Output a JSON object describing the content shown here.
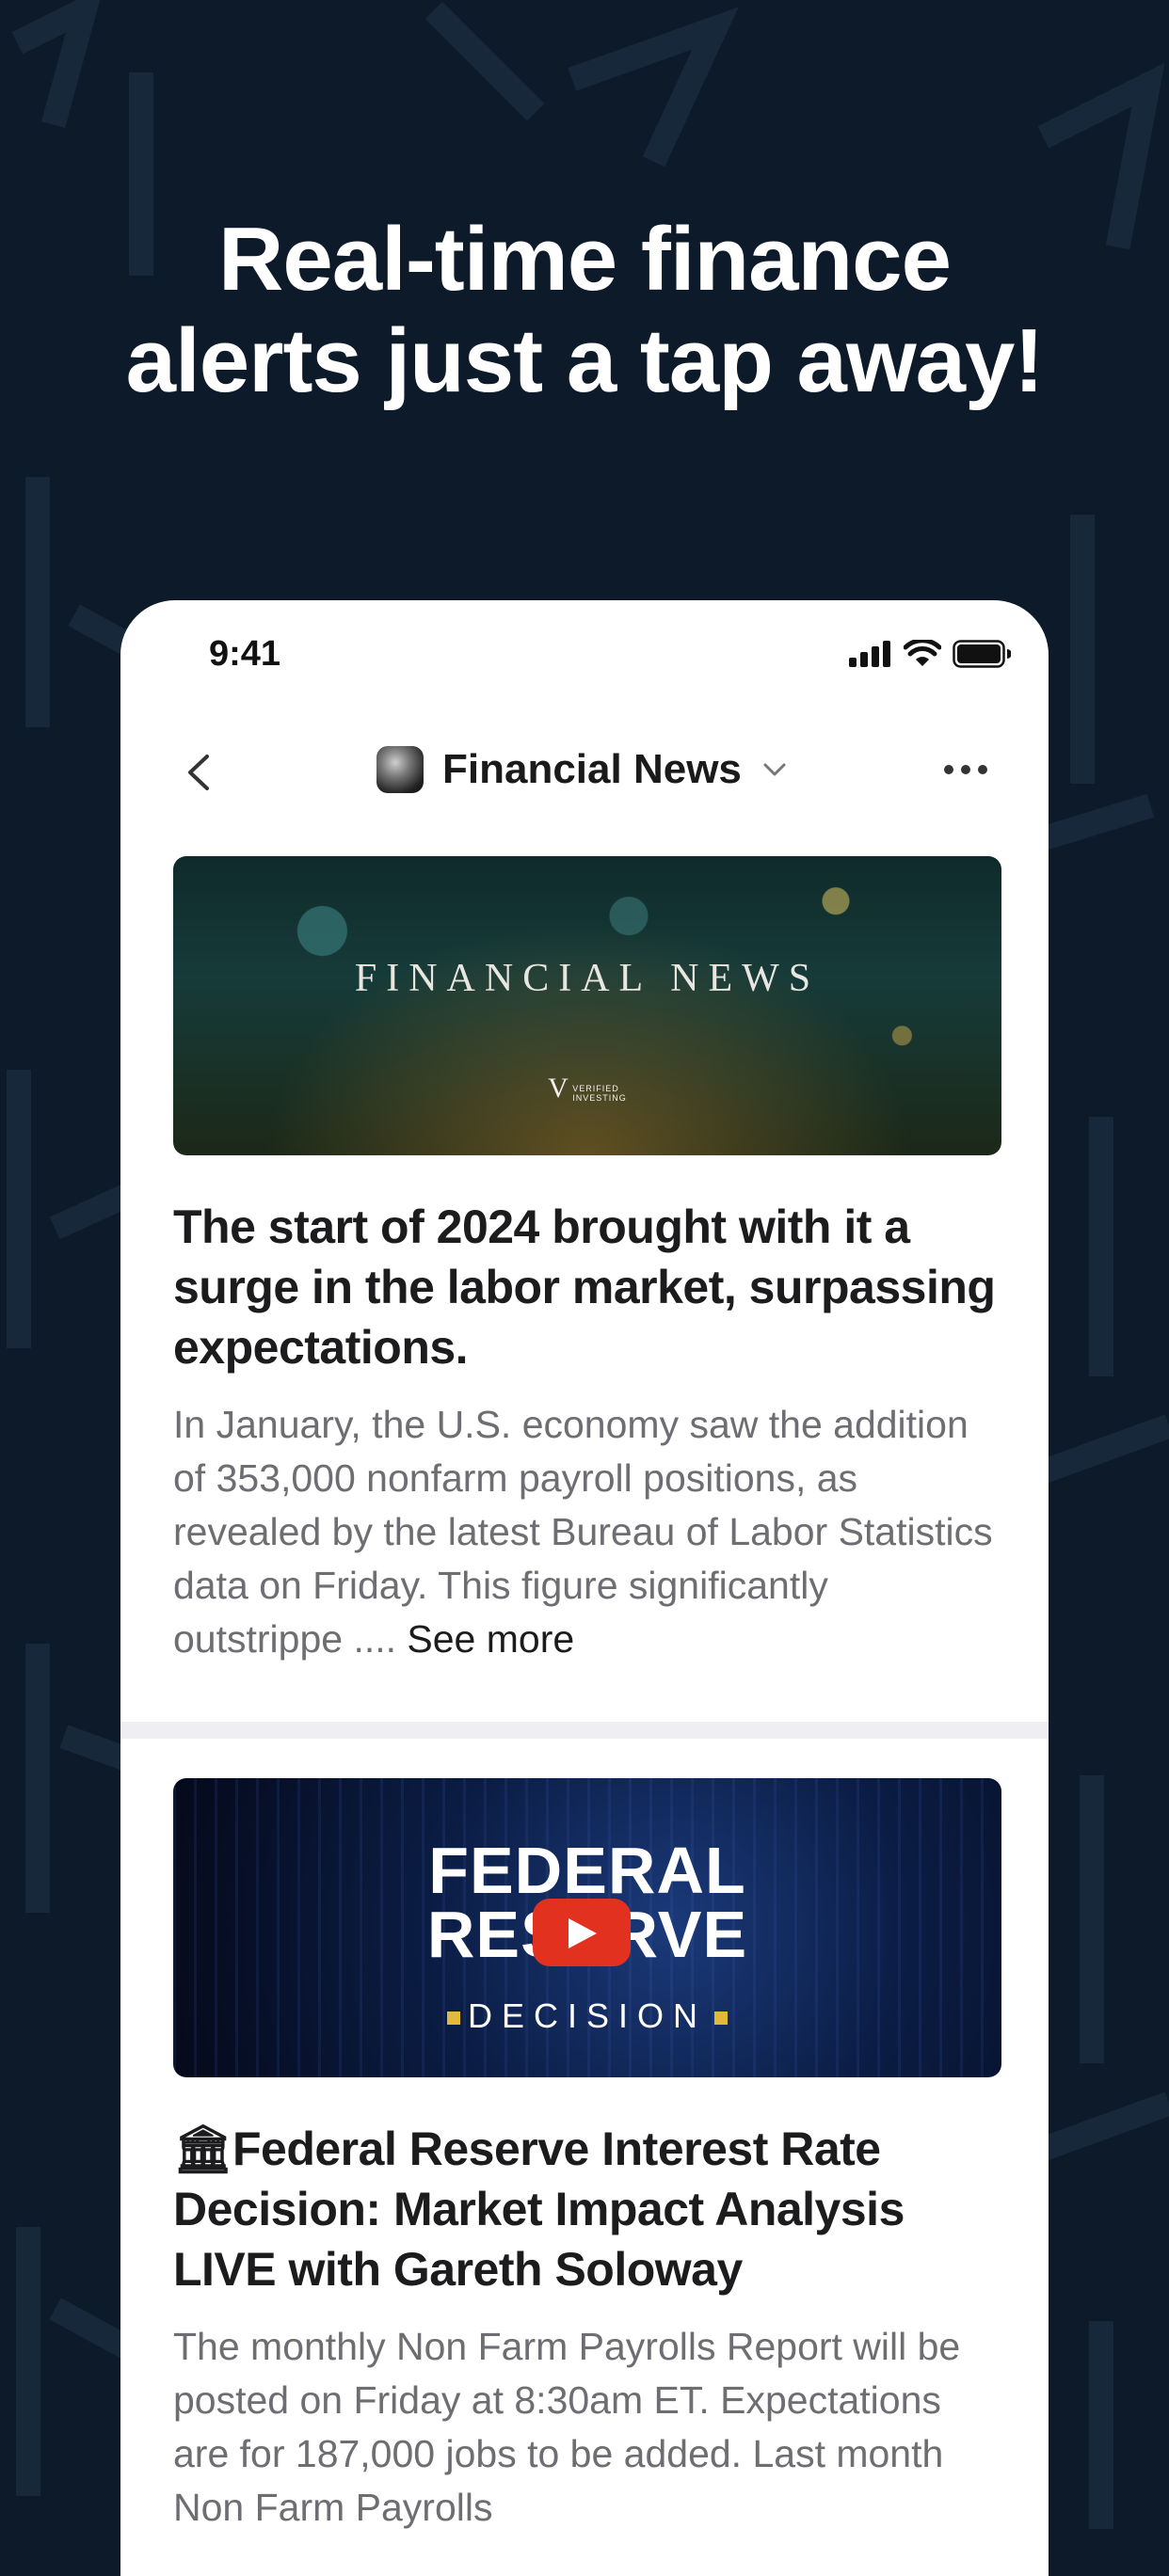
{
  "headline": {
    "line1": "Real-time finance",
    "line2": "alerts just a tap away!"
  },
  "status_bar": {
    "time": "9:41"
  },
  "nav": {
    "channel_name": "Financial News"
  },
  "posts": [
    {
      "banner_title": "FINANCIAL NEWS",
      "banner_logo_line1": "VERIFIED",
      "banner_logo_line2": "INVESTING",
      "title": "The start of 2024 brought with it a surge in the labor market, surpassing expectations.",
      "body": "In January, the U.S. economy saw the addition of 353,000 nonfarm payroll positions, as revealed by the latest Bureau of Labor Statistics data on Friday. This figure significantly outstrippe .... ",
      "see_more": "See more"
    },
    {
      "banner_line1": "FEDERAL",
      "banner_line2": "RESERVE",
      "banner_sub": "DECISION",
      "title_icon": "🏛",
      "title": "Federal Reserve Interest Rate Decision: Market Impact Analysis LIVE with Gareth Soloway",
      "body": "The monthly Non Farm Payrolls Report will be posted on Friday at 8:30am ET. Expectations are for 187,000 jobs to be added. Last month Non Farm Payrolls"
    }
  ],
  "colors": {
    "background": "#0d1a2a",
    "play_button": "#e3311f",
    "accent_gold": "#e2b93b"
  }
}
